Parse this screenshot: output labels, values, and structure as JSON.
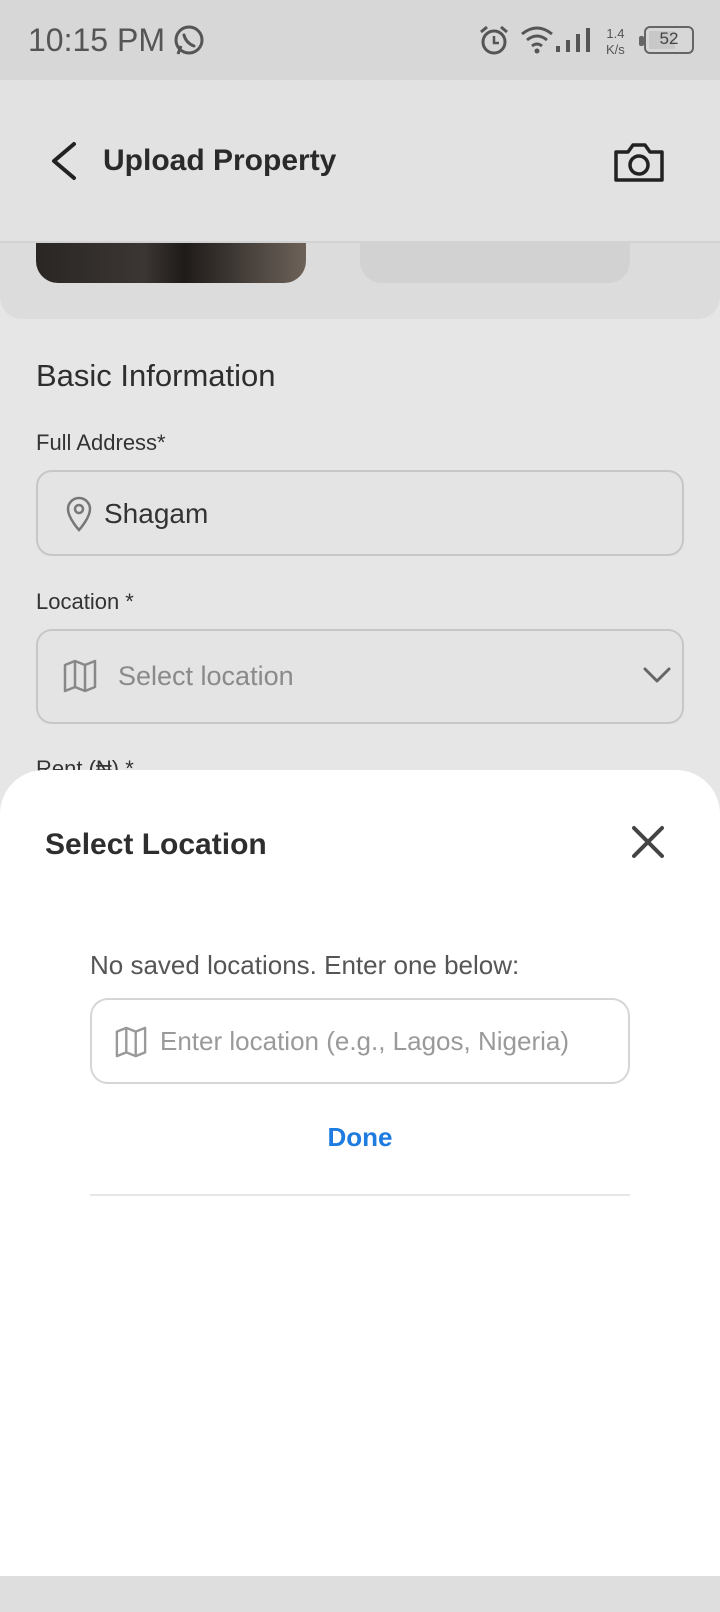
{
  "status_bar": {
    "time": "10:15 PM",
    "net_speed_value": "1.4",
    "net_speed_unit": "K/s",
    "battery": "52",
    "icons": [
      "whatsapp-icon",
      "alarm-icon",
      "wifi-icon",
      "signal-icon",
      "battery-icon"
    ]
  },
  "app_bar": {
    "title": "Upload Property",
    "back_icon": "chevron-left-icon",
    "camera_icon": "camera-icon"
  },
  "form": {
    "section_title": "Basic Information",
    "full_address": {
      "label": "Full Address*",
      "value": "Shagam",
      "icon": "map-pin-icon"
    },
    "location": {
      "label": "Location *",
      "placeholder": "Select location",
      "icon": "map-icon",
      "dropdown_icon": "chevron-down-icon"
    },
    "rent": {
      "label": "Rent (₦) *"
    }
  },
  "sheet": {
    "title": "Select Location",
    "close_icon": "close-icon",
    "message": "No saved locations. Enter one below:",
    "input_placeholder": "Enter location (e.g., Lagos, Nigeria)",
    "input_icon": "map-icon",
    "done_label": "Done"
  },
  "colors": {
    "accent": "#1e7be0",
    "sheet_bg": "#ffffff",
    "overlay_bg": "#e6e6e6"
  }
}
